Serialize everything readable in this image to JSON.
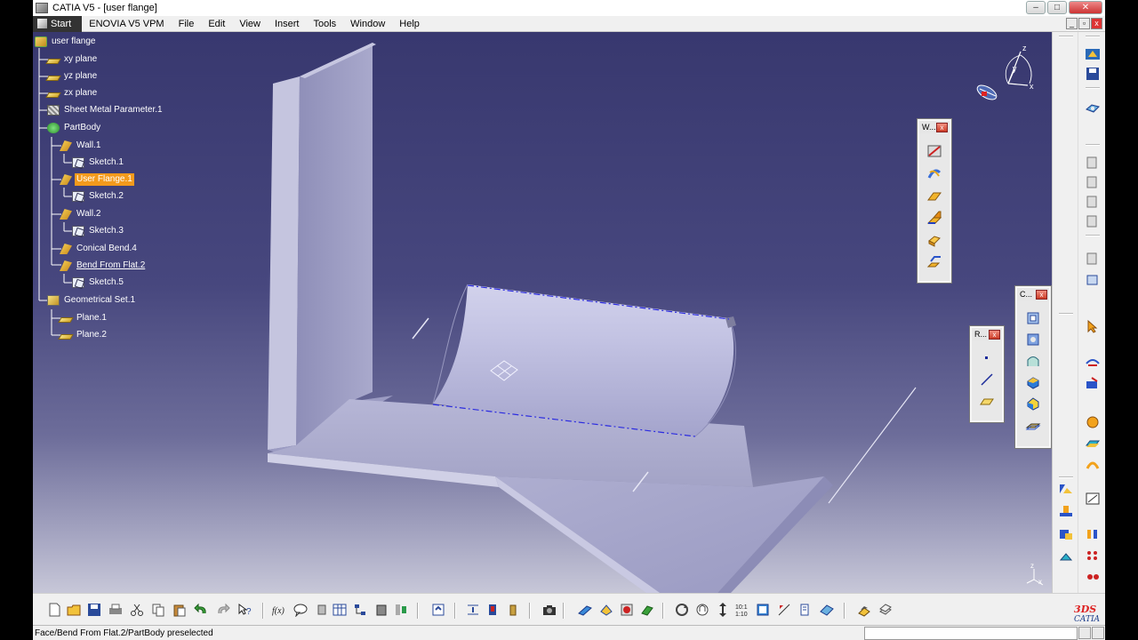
{
  "window": {
    "title": "CATIA V5 - [user flange]",
    "minimize": "‒",
    "maximize": "□",
    "close": "✕"
  },
  "menu": {
    "items": [
      "Start",
      "ENOVIA V5 VPM",
      "File",
      "Edit",
      "View",
      "Insert",
      "Tools",
      "Window",
      "Help"
    ]
  },
  "tree": {
    "nodes": [
      {
        "label": "user flange",
        "icon": "part-icon"
      },
      {
        "label": "xy plane",
        "icon": "plane-icon"
      },
      {
        "label": "yz plane",
        "icon": "plane-icon"
      },
      {
        "label": "zx plane",
        "icon": "plane-icon"
      },
      {
        "label": "Sheet Metal Parameter.1",
        "icon": "sheet-metal-parameter-icon"
      },
      {
        "label": "PartBody",
        "icon": "body-icon"
      },
      {
        "label": "Wall.1",
        "icon": "wall-icon"
      },
      {
        "label": "Sketch.1",
        "icon": "sketch-icon"
      },
      {
        "label": "User Flange.1",
        "icon": "user-flange-icon",
        "state": "highlighted"
      },
      {
        "label": "Sketch.2",
        "icon": "sketch-icon"
      },
      {
        "label": "Wall.2",
        "icon": "wall-icon"
      },
      {
        "label": "Sketch.3",
        "icon": "sketch-icon"
      },
      {
        "label": "Conical Bend.4",
        "icon": "conical-bend-icon"
      },
      {
        "label": "Bend From Flat.2",
        "icon": "bend-from-flat-icon",
        "state": "preselected"
      },
      {
        "label": "Sketch.5",
        "icon": "sketch-icon"
      },
      {
        "label": "Geometrical Set.1",
        "icon": "geometrical-set-icon"
      },
      {
        "label": "Plane.1",
        "icon": "plane-icon"
      },
      {
        "label": "Plane.2",
        "icon": "plane-icon"
      }
    ]
  },
  "compass": {
    "axis_x": "x",
    "axis_y": "y",
    "axis_z": "z"
  },
  "floating_toolbars": {
    "walls": {
      "title": "W...",
      "close": "x",
      "icons": [
        "sheet-metal-parameters-icon",
        "bend-icon",
        "wall-icon",
        "wall-on-edge-icon",
        "extrusion-icon",
        "swept-walls-icon"
      ]
    },
    "reference": {
      "title": "R...",
      "close": "x",
      "icons": [
        "point-icon",
        "line-icon",
        "plane-icon"
      ]
    },
    "constraints": {
      "title": "C...",
      "close": "x",
      "icons": [
        "view-icon",
        "cut-out-icon",
        "stamp-icon",
        "corner-relief-icon",
        "chamfer-icon",
        "pattern-icon"
      ]
    }
  },
  "view_axis": {
    "z": "z",
    "x": "x"
  },
  "status": {
    "message": "Face/Bend From Flat.2/PartBody preselected"
  },
  "brand": {
    "ds": "3DS",
    "name": "CATIA"
  },
  "colors": {
    "viewport_top": "#38386f",
    "viewport_bottom": "#c7c7d8",
    "highlight": "#f39a1c",
    "part": "#b7b7d6"
  }
}
